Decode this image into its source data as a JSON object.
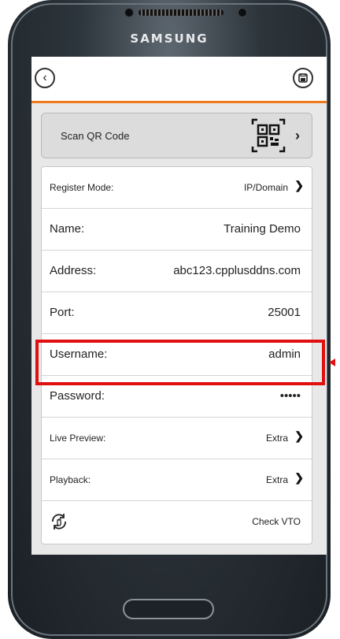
{
  "device": {
    "brand": "SAMSUNG"
  },
  "header": {
    "back_icon": "chevron-left-circle-icon",
    "save_icon": "save-circle-icon"
  },
  "qr": {
    "label": "Scan QR Code",
    "icon": "qr-code-icon"
  },
  "rows": [
    {
      "label": "Register Mode:",
      "value": "IP/Domain",
      "chevron": true,
      "small": true
    },
    {
      "label": "Name:",
      "value": "Training Demo",
      "chevron": false,
      "small": false
    },
    {
      "label": "Address:",
      "value": "abc123.cpplusddns.com",
      "chevron": false,
      "small": false
    },
    {
      "label": "Port:",
      "value": "25001",
      "chevron": false,
      "small": false
    },
    {
      "label": "Username:",
      "value": "admin",
      "chevron": false,
      "small": false
    },
    {
      "label": "Password:",
      "value": "•••••",
      "chevron": false,
      "small": false
    },
    {
      "label": "Live Preview:",
      "value": "Extra",
      "chevron": true,
      "small": true
    },
    {
      "label": "Playback:",
      "value": "Extra",
      "chevron": true,
      "small": true
    },
    {
      "label": "",
      "value": "Check VTO",
      "chevron": false,
      "small": true,
      "icon": "refresh-hand-icon"
    }
  ],
  "colors": {
    "accent": "#f07a1c",
    "highlight": "#e01010"
  }
}
